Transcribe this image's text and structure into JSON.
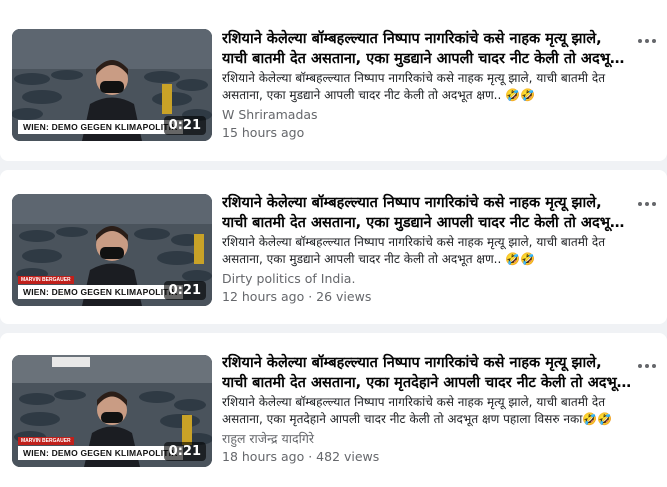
{
  "results": [
    {
      "title_line1": "रशियाने केलेल्या बॉम्बहल्ल्यात निष्पाप नागरिकांचे कसे नाहक मृत्यू झाले,",
      "title_line2": "याची बातमी देत असताना, एका मुडद्याने आपली चादर नीट केली तो अदभूत…",
      "description": "रशियाने केलेल्या बॉम्बहल्ल्यात निष्पाप नागरिकांचे कसे नाहक मृत्यू झाले, याची बातमी देत असताना, एका मुडद्याने आपली चादर नीट केली तो अदभूत क्षण.. 🤣🤣",
      "author": "W Shriramadas",
      "meta": "15 hours ago",
      "duration": "0:21",
      "caption": "WIEN: DEMO GEGEN KLIMAPOLITIK",
      "lower_tag": ""
    },
    {
      "title_line1": "रशियाने केलेल्या बॉम्बहल्ल्यात निष्पाप नागरिकांचे कसे नाहक मृत्यू झाले,",
      "title_line2": "याची बातमी देत असताना, एका मुडद्याने आपली चादर नीट केली तो अदभूत…",
      "description": "रशियाने केलेल्या बॉम्बहल्ल्यात निष्पाप नागरिकांचे कसे नाहक मृत्यू झाले, याची बातमी देत असताना, एका मुडद्याने आपली चादर नीट केली तो अदभूत क्षण.. 🤣🤣",
      "author": "Dirty politics of India.",
      "meta": "12 hours ago · 26 views",
      "duration": "0:21",
      "caption": "WIEN: DEMO GEGEN KLIMAPOLITIK",
      "lower_tag": "MARVIN BERGAUER"
    },
    {
      "title_line1": "रशियाने केलेल्या बॉम्बहल्ल्यात निष्पाप नागरिकांचे कसे नाहक मृत्यू झाले,",
      "title_line2": "याची बातमी देत असताना, एका मृतदेहाने आपली चादर नीट केली तो अदभू…",
      "description": "रशियाने केलेल्या बॉम्बहल्ल्यात निष्पाप नागरिकांचे कसे नाहक मृत्यू झाले, याची बातमी देत असताना, एका मृतदेहाने आपली चादर नीट केली तो अदभूत क्षण पहाला विसरु नका🤣🤣",
      "author": "राहुल राजेन्द्र यादगिरे",
      "meta": "18 hours ago · 482 views",
      "duration": "0:21",
      "caption": "WIEN: DEMO GEGEN KLIMAPOLITIK",
      "lower_tag": "MARVIN BERGAUER"
    }
  ],
  "icons": {
    "more": "more-horizontal-icon",
    "play_overlay": "video-thumbnail"
  }
}
